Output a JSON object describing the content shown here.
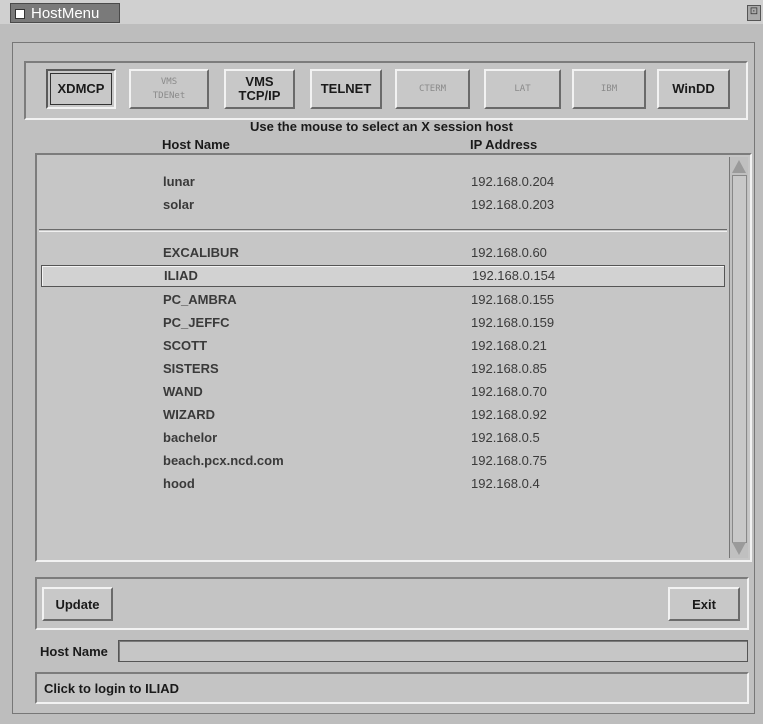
{
  "window": {
    "title": "HostMenu"
  },
  "toolbar": {
    "buttons": [
      {
        "label": "XDMCP",
        "selected": true,
        "enabled": true
      },
      {
        "label": "VMS\nTDENet",
        "selected": false,
        "enabled": false
      },
      {
        "label": "VMS\nTCP/IP",
        "selected": false,
        "enabled": true
      },
      {
        "label": "TELNET",
        "selected": false,
        "enabled": true
      },
      {
        "label": "CTERM",
        "selected": false,
        "enabled": false
      },
      {
        "label": "LAT",
        "selected": false,
        "enabled": false
      },
      {
        "label": "IBM",
        "selected": false,
        "enabled": false
      },
      {
        "label": "WinDD",
        "selected": false,
        "enabled": true
      }
    ]
  },
  "instruction": "Use the mouse to select an X session host",
  "columns": {
    "host": "Host Name",
    "ip": "IP Address"
  },
  "hosts_top": [
    {
      "name": "lunar",
      "ip": "192.168.0.204"
    },
    {
      "name": "solar",
      "ip": "192.168.0.203"
    }
  ],
  "hosts": [
    {
      "name": "EXCALIBUR",
      "ip": "192.168.0.60"
    },
    {
      "name": "ILIAD",
      "ip": "192.168.0.154",
      "selected": true
    },
    {
      "name": "PC_AMBRA",
      "ip": "192.168.0.155"
    },
    {
      "name": "PC_JEFFC",
      "ip": "192.168.0.159"
    },
    {
      "name": "SCOTT",
      "ip": "192.168.0.21"
    },
    {
      "name": "SISTERS",
      "ip": "192.168.0.85"
    },
    {
      "name": "WAND",
      "ip": "192.168.0.70"
    },
    {
      "name": "WIZARD",
      "ip": "192.168.0.92"
    },
    {
      "name": "bachelor",
      "ip": "192.168.0.5"
    },
    {
      "name": "beach.pcx.ncd.com",
      "ip": "192.168.0.75"
    },
    {
      "name": "hood",
      "ip": "192.168.0.4"
    }
  ],
  "actions": {
    "update": "Update",
    "exit": "Exit"
  },
  "host_field": {
    "label": "Host Name",
    "value": ""
  },
  "status": "Click to login to ILIAD"
}
